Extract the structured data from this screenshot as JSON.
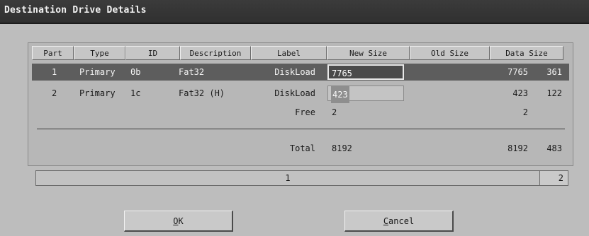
{
  "window": {
    "title": "Destination Drive Details"
  },
  "table": {
    "columns": [
      "Part",
      "Type",
      "ID",
      "Description",
      "Label",
      "New Size",
      "Old Size",
      "Data Size"
    ],
    "rows": [
      {
        "part": "1",
        "type": "Primary",
        "id": "0b",
        "description": "Fat32",
        "label": "DiskLoad",
        "new_size": "7765",
        "old_size": "7765",
        "data_size": "361",
        "selected": true
      },
      {
        "part": "2",
        "type": "Primary",
        "id": "1c",
        "description": "Fat32 (H)",
        "label": "DiskLoad",
        "new_size": "423",
        "old_size": "423",
        "data_size": "122",
        "selected": false
      }
    ],
    "free": {
      "label": "Free",
      "new_size": "2",
      "old_size": "2"
    },
    "total": {
      "label": "Total",
      "new_size": "8192",
      "old_size": "8192",
      "data_size": "483"
    }
  },
  "partition_bar": {
    "segments": [
      "1",
      "2"
    ]
  },
  "buttons": {
    "ok": {
      "mnemonic": "O",
      "rest": "K"
    },
    "cancel": {
      "mnemonic": "C",
      "rest": "ancel"
    }
  }
}
